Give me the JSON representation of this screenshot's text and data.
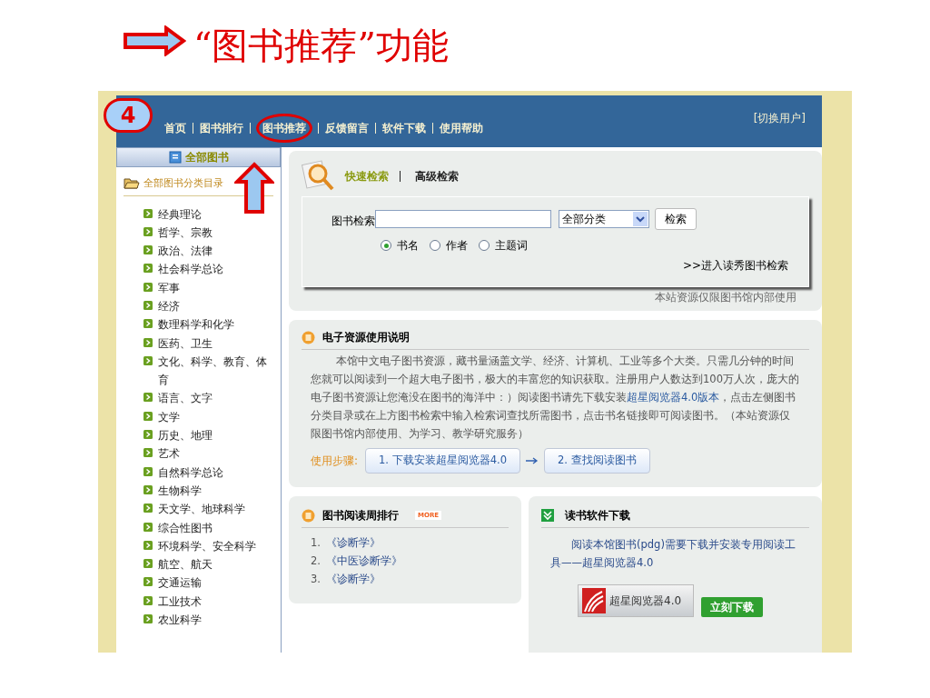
{
  "slide": {
    "title": "“图书推荐”功能",
    "badge": "4"
  },
  "header": {
    "user_link": "[切换用户]",
    "nav": [
      {
        "label": "首页",
        "highlighted": false
      },
      {
        "label": "图书排行",
        "highlighted": false
      },
      {
        "label": "图书推荐",
        "highlighted": true
      },
      {
        "label": "反馈留言",
        "highlighted": false
      },
      {
        "label": "软件下载",
        "highlighted": false
      },
      {
        "label": "使用帮助",
        "highlighted": false
      }
    ]
  },
  "sidebar": {
    "heading": "全部图书",
    "catalog": "全部图书分类目录",
    "categories": [
      "经典理论",
      "哲学、宗教",
      "政治、法律",
      "社会科学总论",
      "军事",
      "经济",
      "数理科学和化学",
      "医药、卫生",
      "文化、科学、教育、体育",
      "语言、文字",
      "文学",
      "历史、地理",
      "艺术",
      "自然科学总论",
      "生物科学",
      "天文学、地球科学",
      "综合性图书",
      "环境科学、安全科学",
      "航空、航天",
      "交通运输",
      "工业技术",
      "农业科学"
    ]
  },
  "search": {
    "tabs": [
      {
        "label": "快速检索",
        "selected": true
      },
      {
        "label": "高级检索",
        "selected": false
      }
    ],
    "field_label": "图书检索",
    "category": "全部分类",
    "button": "检索",
    "radios": [
      {
        "label": "书名",
        "selected": true
      },
      {
        "label": "作者",
        "selected": false
      },
      {
        "label": "主题词",
        "selected": false
      }
    ],
    "link": ">>进入读秀图书检索",
    "note": "本站资源仅限图书馆内部使用"
  },
  "guide": {
    "title": "电子资源使用说明",
    "text_before": "本馆中文电子图书资源，藏书量涵盖文学、经济、计算机、工业等多个大类。只需几分钟的时间您就可以阅读到一个超大电子图书，极大的丰富您的知识获取。注册用户人数达到100万人次，庞大的电子图书资源让您淹没在图书的海洋中：）阅读图书请先下载安装",
    "link": "超星阅览器4.0版本",
    "text_after": "，点击左侧图书分类目录或在上方图书检索中输入检索词查找所需图书，点击书名链接即可阅读图书。（本站资源仅限图书馆内部使用、为学习、教学研究服务）",
    "steps_label": "使用步骤:",
    "steps": [
      "1. 下载安装超星阅览器4.0",
      "2. 查找阅读图书"
    ]
  },
  "ranking": {
    "title": "图书阅读周排行",
    "more": "MORE",
    "items": [
      {
        "number": "1.",
        "title": "《诊断学》"
      },
      {
        "number": "2.",
        "title": "《中医诊断学》"
      },
      {
        "number": "3.",
        "title": "《诊断学》"
      }
    ]
  },
  "download": {
    "title": "读书软件下载",
    "text": "阅读本馆图书(pdg)需要下载并安装专用阅读工具——超星阅览器4.0",
    "product": "超星阅览器4.0",
    "button": "立刻下载"
  }
}
